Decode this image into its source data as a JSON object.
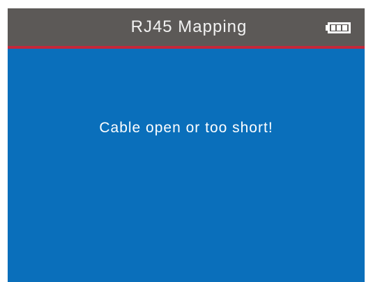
{
  "header": {
    "title": "RJ45 Mapping",
    "battery_icon": "battery-full-icon",
    "battery_level": 1.0
  },
  "main": {
    "message": "Cable open or too short!"
  },
  "colors": {
    "header_bg": "#5c5957",
    "header_line": "#c5283a",
    "screen_bg": "#0a6fbb",
    "text": "#ffffff"
  }
}
